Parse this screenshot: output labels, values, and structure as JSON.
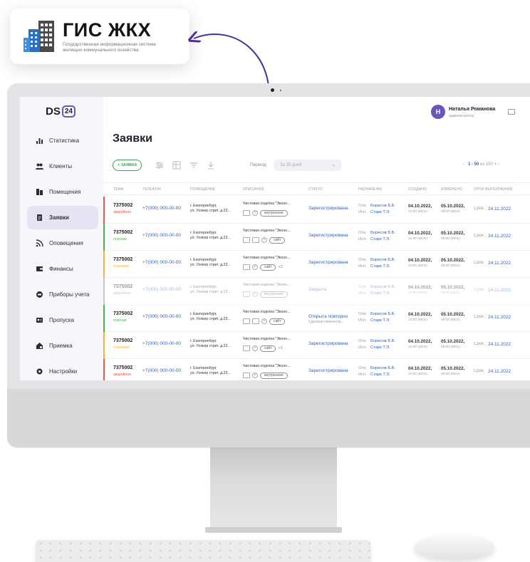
{
  "gis": {
    "title": "ГИС ЖКХ",
    "subtitle": "Государственная информационная система жилищно-коммунального хозяйства"
  },
  "brand": {
    "name": "DS",
    "badge": "24"
  },
  "user": {
    "initial": "Н",
    "name": "Наталья Романова",
    "role": "администратор"
  },
  "sidebar": {
    "items": [
      {
        "label": "Статистика",
        "icon": "chart-icon"
      },
      {
        "label": "Клиенты",
        "icon": "users-icon"
      },
      {
        "label": "Помещения",
        "icon": "building-icon"
      },
      {
        "label": "Заявки",
        "icon": "document-icon",
        "active": true
      },
      {
        "label": "Оповещения",
        "icon": "broadcast-icon"
      },
      {
        "label": "Финансы",
        "icon": "wallet-icon"
      },
      {
        "label": "Приборы учета",
        "icon": "meter-icon"
      },
      {
        "label": "Пропуска",
        "icon": "badge-icon"
      },
      {
        "label": "Приемка",
        "icon": "house-icon"
      },
      {
        "label": "Настройки",
        "icon": "gear-icon"
      }
    ]
  },
  "page": {
    "title": "Заявки"
  },
  "toolbar": {
    "add_label": "+ ЗАЯВКА",
    "period_label": "Период",
    "period_value": "За 30 дней",
    "pager_range": "1 - 50",
    "pager_rest": "из 100 +"
  },
  "columns": [
    "ТЕМА",
    "ТЕЛЕФОН",
    "ПОМЕЩЕНИЕ",
    "ОПИСАНИЕ",
    "СТАТУС",
    "НАЗНАЧЕНЫ",
    "СОЗДАНО",
    "ИЗМЕНЕНО",
    "СРОК ВЫПОЛНЕНИЯ"
  ],
  "rows": [
    {
      "num": "7375002",
      "type": "аварийная",
      "type_color": "#e8584f",
      "phone": "+7(000) 000-00-00",
      "addr1": "г. Екатеринбург,",
      "addr2": "ул. Уолкер стрит, д.23...",
      "desc": "Чистовая отделка \"Эконо...",
      "chips": [
        "внутренние"
      ],
      "more": "",
      "status": "Зарегистрирована",
      "status2": "",
      "otv_label": "Отв.",
      "otv": "Борисов Б.Б.",
      "isp_label": "Исп.",
      "isp": "Старк Т.Э.",
      "created": "04.10.2022,",
      "created_t": "12:00 (МСК)",
      "changed": "05.10.2022,",
      "changed_t": "09:00 (МСК)",
      "due_label": "Срок:",
      "due": "24.11.2022",
      "dim": false
    },
    {
      "num": "7375002",
      "type": "платная",
      "type_color": "#4caf50",
      "phone": "+7(000) 000-00-00",
      "addr1": "г. Екатеринбург,",
      "addr2": "ул. Уолкер стрит, д.23...",
      "desc": "Чистовая отделка \"Эконо...",
      "chips": [
        "сайт"
      ],
      "more": "",
      "status": "Зарегистрирована",
      "status2": "",
      "otv_label": "Отв.",
      "otv": "Борисов Б.Б.",
      "isp_label": "Исп.",
      "isp": "Старк Т.Э.",
      "created": "04.10.2022,",
      "created_t": "12:00 (МСК)",
      "changed": "05.10.2022,",
      "changed_t": "09:00 (МСК)",
      "due_label": "Срок:",
      "due": "24.11.2022",
      "dim": false
    },
    {
      "num": "7375002",
      "type": "плановая",
      "type_color": "#f0b43c",
      "phone": "+7(000) 000-00-00",
      "addr1": "г. Екатеринбург,",
      "addr2": "ул. Уолкер стрит, д.23...",
      "desc": "Чистовая отделка \"Эконо...",
      "chips": [
        "сайт"
      ],
      "more": "+3",
      "status": "Зарегистрирована",
      "status2": "",
      "otv_label": "Отв.",
      "otv": "Борисов Б.Б.",
      "isp_label": "Исп.",
      "isp": "Старк Т.Э.",
      "created": "04.10.2022,",
      "created_t": "12:00 (МСК)",
      "changed": "05.10.2022,",
      "changed_t": "09:00 (МСК)",
      "due_label": "Срок:",
      "due": "24.11.2022",
      "dim": false
    },
    {
      "num": "7375002",
      "type": "аварийная",
      "type_color": "#888888",
      "phone": "+7(000) 000-00-00",
      "addr1": "г. Екатеринбург,",
      "addr2": "ул. Уолкер стрит, д.23...",
      "desc": "Чистовая отделка \"Эконо...",
      "chips": [
        "внутренние"
      ],
      "more": "",
      "status": "Закрыта",
      "status2": "",
      "otv_label": "Отв.",
      "otv": "Борисов Б.Б.",
      "isp_label": "Исп.",
      "isp": "Старк Т.Э.",
      "created": "04.10.2022,",
      "created_t": "12:00 (МСК)",
      "changed": "05.10.2022,",
      "changed_t": "09:00 (МСК)",
      "due_label": "Срок:",
      "due": "24.11.2022",
      "dim": true
    },
    {
      "num": "7375002",
      "type": "платная",
      "type_color": "#4caf50",
      "phone": "+7(000) 000-00-00",
      "addr1": "г. Екатеринбург,",
      "addr2": "ул. Уолкер стрит, д.23...",
      "desc": "Чистовая отделка \"Эконо...",
      "chips": [
        "сайт"
      ],
      "more": "",
      "status": "Открыта повторно",
      "status2": "Сделали некачеств...",
      "otv_label": "Отв.",
      "otv": "Борисов Б.Б.",
      "isp_label": "Исп.",
      "isp": "Старк Т.Э.",
      "created": "04.10.2022,",
      "created_t": "12:00 (МСК)",
      "changed": "05.10.2022,",
      "changed_t": "09:00 (МСК)",
      "due_label": "Срок:",
      "due": "24.11.2022",
      "dim": false
    },
    {
      "num": "7375002",
      "type": "плановая",
      "type_color": "#f0b43c",
      "phone": "+7(000) 000-00-00",
      "addr1": "г. Екатеринбург,",
      "addr2": "ул. Уолкер стрит, д.23...",
      "desc": "Чистовая отделка \"Эконо...",
      "chips": [
        "сайт"
      ],
      "more": "+3",
      "status": "Зарегистрирована",
      "status2": "",
      "otv_label": "Отв.",
      "otv": "Борисов Б.Б.",
      "isp_label": "Исп.",
      "isp": "Старк Т.Э.",
      "created": "04.10.2022,",
      "created_t": "12:00 (МСК)",
      "changed": "05.10.2022,",
      "changed_t": "09:00 (МСК)",
      "due_label": "Срок:",
      "due": "24.11.2022",
      "dim": false
    },
    {
      "num": "7375002",
      "type": "аварийная",
      "type_color": "#e8584f",
      "phone": "+7(000) 000-00-00",
      "addr1": "г. Екатеринбург,",
      "addr2": "ул. Уолкер стрит, д.23...",
      "desc": "Чистовая отделка \"Эконо...",
      "chips": [
        "внутренние"
      ],
      "more": "",
      "status": "Зарегистрирована",
      "status2": "",
      "otv_label": "Отв.",
      "otv": "Борисов Б.Б.",
      "isp_label": "Исп.",
      "isp": "Старк Т.Э.",
      "created": "04.10.2022,",
      "created_t": "12:00 (МСК)",
      "changed": "05.10.2022,",
      "changed_t": "09:00 (МСК)",
      "due_label": "Срок:",
      "due": "24.11.2022",
      "dim": false
    }
  ],
  "colors": {
    "accent": "#6a55b8",
    "link": "#2f62c4",
    "add": "#3aa35a",
    "gis_blue": "#2b6fc2"
  }
}
